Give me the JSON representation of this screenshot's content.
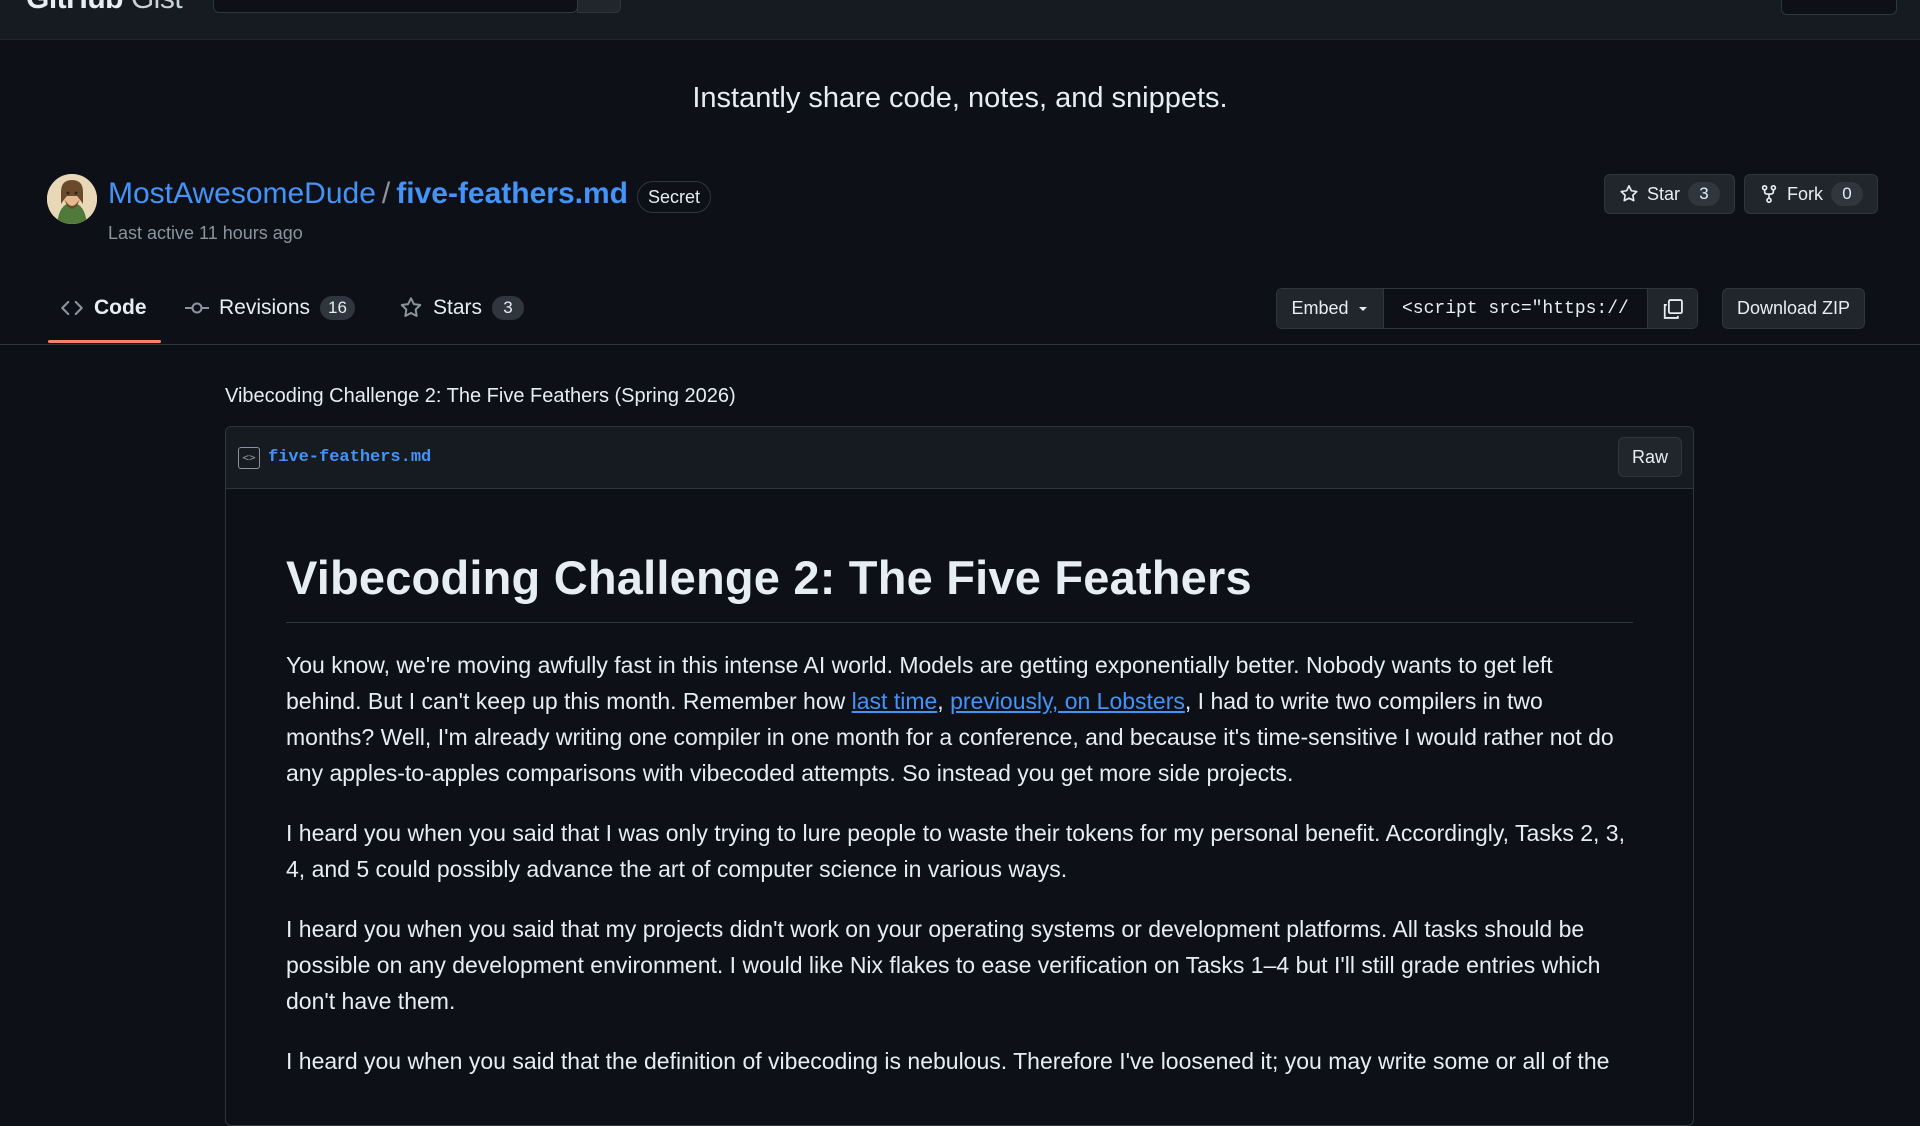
{
  "topbar": {
    "logo_main": "GitHub",
    "logo_sub": "Gist"
  },
  "tagline": "Instantly share code, notes, and snippets.",
  "gist": {
    "owner": "MostAwesomeDude",
    "separator": "/",
    "filename": "five-feathers.md",
    "visibility": "Secret",
    "last_active": "Last active 11 hours ago"
  },
  "actions": {
    "star_label": "Star",
    "star_count": "3",
    "fork_label": "Fork",
    "fork_count": "0",
    "embed_label": "Embed",
    "embed_value": "<script src=\"https://",
    "download_label": "Download ZIP"
  },
  "tabs": [
    {
      "label": "Code"
    },
    {
      "label": "Revisions",
      "count": "16"
    },
    {
      "label": "Stars",
      "count": "3"
    }
  ],
  "description": "Vibecoding Challenge 2: The Five Feathers (Spring 2026)",
  "file": {
    "name": "five-feathers.md",
    "raw_label": "Raw"
  },
  "markdown": {
    "h1": "Vibecoding Challenge 2: The Five Feathers",
    "p1_a": "You know, we're moving awfully fast in this intense AI world. Models are getting exponentially better. Nobody wants to get left behind. But I can't keep up this month. Remember how ",
    "p1_link1": "last time",
    "p1_comma": ", ",
    "p1_link2": "previously, on Lobsters",
    "p1_b": ", I had to write two compilers in two months? Well, I'm already writing one compiler in one month for a conference, and because it's time-sensitive I would rather not do any apples-to-apples comparisons with vibecoded attempts. So instead you get more side projects.",
    "p2": "I heard you when you said that I was only trying to lure people to waste their tokens for my personal benefit. Accordingly, Tasks 2, 3, 4, and 5 could possibly advance the art of computer science in various ways.",
    "p3": "I heard you when you said that my projects didn't work on your operating systems or development platforms. All tasks should be possible on any development environment. I would like Nix flakes to ease verification on Tasks 1–4 but I'll still grade entries which don't have them.",
    "p4": "I heard you when you said that the definition of vibecoding is nebulous. Therefore I've loosened it; you may write some or all of the"
  },
  "colors": {
    "background": "#0d1117",
    "link": "#4493f8",
    "tab_active": "#f78166",
    "border": "#30363d"
  }
}
